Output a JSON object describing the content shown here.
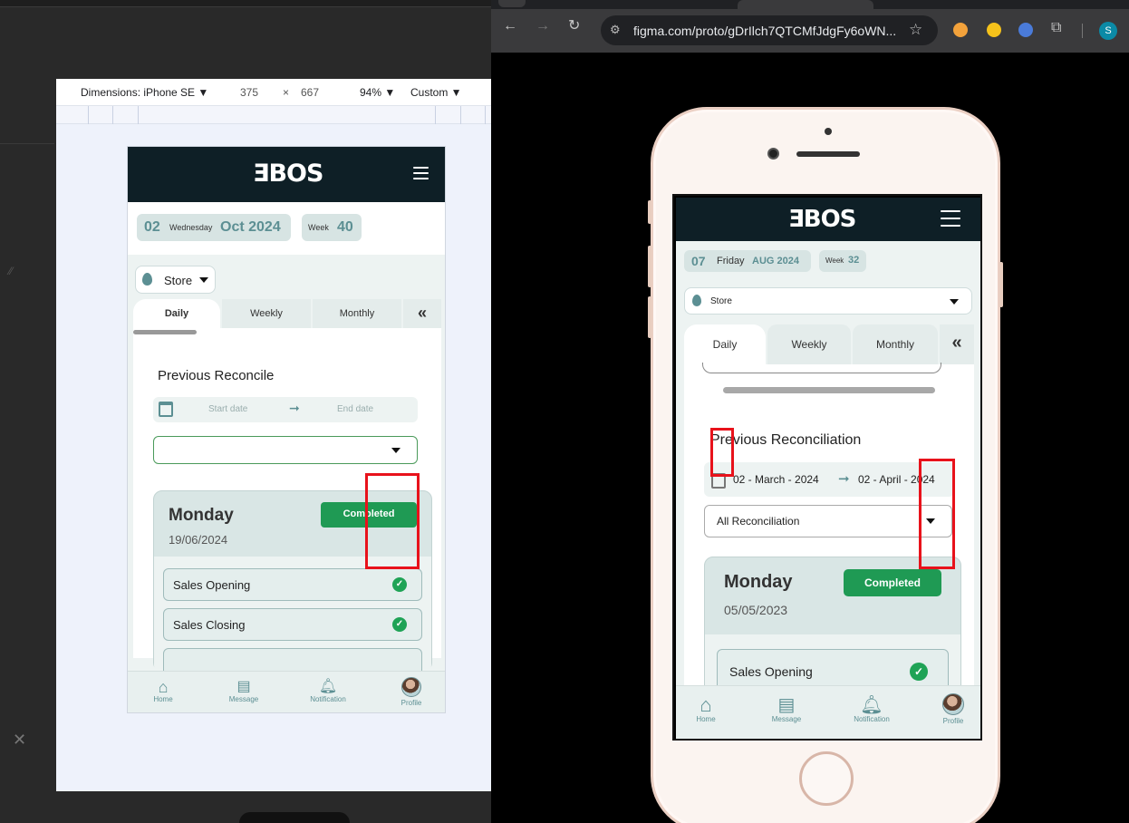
{
  "devtools": {
    "dimensions_label": "Dimensions: iPhone SE ▼",
    "width": "375",
    "times": "×",
    "height": "667",
    "zoom": "94% ▼",
    "throttle": "Custom ▼"
  },
  "browser": {
    "url": "figma.com/proto/gDrIlch7QTCMfJdgFy6oWN...",
    "profile_initial": "S"
  },
  "left_app": {
    "logo": "ƎBOS",
    "date": {
      "day": "02",
      "weekday": "Wednesday",
      "month_year": "Oct 2024",
      "week_label": "Week",
      "week_num": "40"
    },
    "store_label": "Store",
    "tabs": [
      "Daily",
      "Weekly",
      "Monthly"
    ],
    "section_title": "Previous Reconcile",
    "start_placeholder": "Start date",
    "end_placeholder": "End date",
    "filter_value": "",
    "card": {
      "day": "Monday",
      "date": "19/06/2024",
      "status": "Completed"
    },
    "tasks": [
      "Sales Opening",
      "Sales Closing"
    ],
    "nav": [
      "Home",
      "Message",
      "Notification",
      "Profile"
    ]
  },
  "right_app": {
    "logo": "ƎBOS",
    "date": {
      "day": "07",
      "weekday": "Friday",
      "month_year": "AUG 2024",
      "week_label": "Week",
      "week_num": "32"
    },
    "store_label": "Store",
    "tabs": [
      "Daily",
      "Weekly",
      "Monthly"
    ],
    "section_title": "Previous Reconciliation",
    "start_date": "02 - March - 2024",
    "end_date": "02 - April - 2024",
    "filter_value": "All Reconciliation",
    "card": {
      "day": "Monday",
      "date": "05/05/2023",
      "status": "Completed"
    },
    "tasks": [
      "Sales Opening"
    ],
    "nav": [
      "Home",
      "Message",
      "Notification",
      "Profile"
    ]
  },
  "colors": {
    "header": "#0e1f26",
    "accent": "#5c8f93",
    "completed": "#1f9a54",
    "annotation": "#e8121b"
  }
}
